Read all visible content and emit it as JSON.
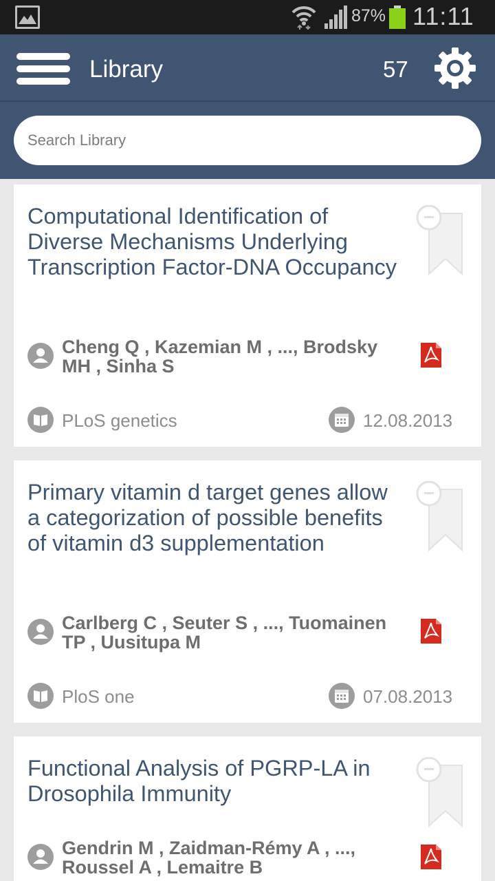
{
  "status_bar": {
    "battery_percent": "87%",
    "time": "11:11",
    "icons": [
      "gallery-icon",
      "wifi-icon",
      "signal-icon",
      "battery-icon"
    ],
    "battery_color": "#8bd11a"
  },
  "header": {
    "title": "Library",
    "count": "57",
    "background_color": "#3f5572",
    "icons": [
      "menu-icon",
      "gear-icon"
    ]
  },
  "search": {
    "placeholder": "Search Library",
    "value": ""
  },
  "articles": [
    {
      "title": "Computational Identification of Diverse Mechanisms Underlying Transcription Factor-DNA Occupancy",
      "authors": "Cheng Q , Kazemian M , ..., Brodsky MH , Sinha S",
      "journal": "PLoS genetics",
      "date": "12.08.2013"
    },
    {
      "title": "Primary vitamin d target genes allow a categorization of possible benefits of vitamin d3 supplementation",
      "authors": "Carlberg C , Seuter S , ..., Tuomainen TP , Uusitupa M",
      "journal": "PloS one",
      "date": "07.08.2013"
    },
    {
      "title": "Functional Analysis of PGRP-LA in Drosophila Immunity",
      "authors": "Gendrin M , Zaidman-Rémy A , ..., Roussel A , Lemaitre B",
      "journal": "",
      "date": ""
    }
  ]
}
